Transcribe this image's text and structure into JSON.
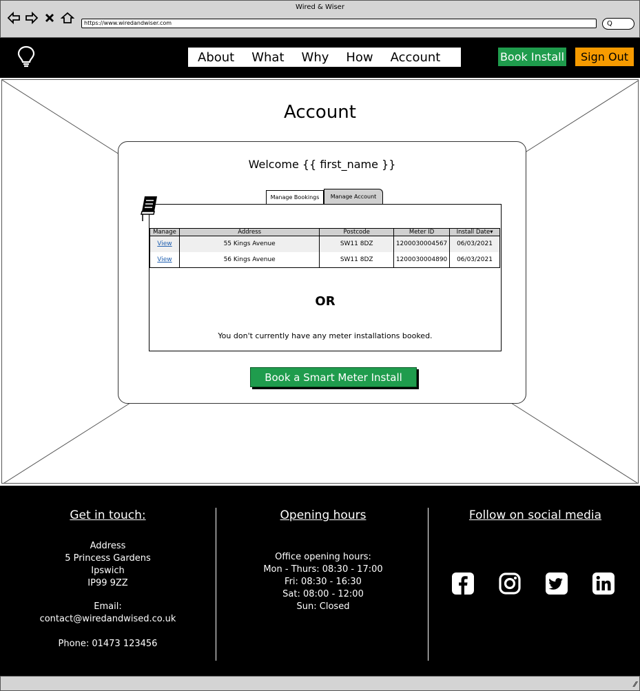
{
  "browser": {
    "window_title": "Wired & Wiser",
    "url": "https://www.wiredandwiser.com",
    "search_glyph": "Q"
  },
  "nav": {
    "items": [
      "About",
      "What",
      "Why",
      "How",
      "Account"
    ],
    "book_install": "Book Install",
    "sign_out": "Sign Out"
  },
  "page": {
    "title": "Account",
    "welcome": "Welcome {{ first_name }}",
    "tabs": [
      "Manage Bookings",
      "Manage Account"
    ],
    "active_tab": "Manage Bookings",
    "table": {
      "headers": [
        "Manage",
        "Address",
        "Postcode",
        "Meter ID",
        "Install Date"
      ],
      "sort_indicator": "▾",
      "rows": [
        {
          "manage": "View",
          "address": "55 Kings Avenue",
          "postcode": "SW11 8DZ",
          "meter_id": "1200030004567",
          "install_date": "06/03/2021"
        },
        {
          "manage": "View",
          "address": "56 Kings Avenue",
          "postcode": "SW11 8DZ",
          "meter_id": "1200030004890",
          "install_date": "06/03/2021"
        }
      ]
    },
    "or_text": "OR",
    "empty_message": "You don't currently have any meter installations booked.",
    "book_button": "Book a Smart Meter Install"
  },
  "footer": {
    "contact": {
      "heading": "Get in touch:",
      "address_label": "Address",
      "address_line1": "5 Princess Gardens",
      "address_line2": "Ipswich",
      "address_line3": "IP99 9ZZ",
      "email_label": "Email:",
      "email": "contact@wiredandwised.co.uk",
      "phone": "Phone:  01473 123456"
    },
    "hours": {
      "heading": "Opening hours",
      "intro": "Office opening hours:",
      "lines": [
        "Mon - Thurs:  08:30 - 17:00",
        "Fri:  08:30 - 16:30",
        "Sat:  08:00 - 12:00",
        "Sun:  Closed"
      ]
    },
    "social": {
      "heading": "Follow on social media",
      "icons": [
        "facebook-icon",
        "instagram-icon",
        "twitter-icon",
        "linkedin-icon"
      ]
    }
  },
  "colors": {
    "green": "#1f9c4d",
    "orange": "#f79b00",
    "link": "#1f5fb0"
  }
}
